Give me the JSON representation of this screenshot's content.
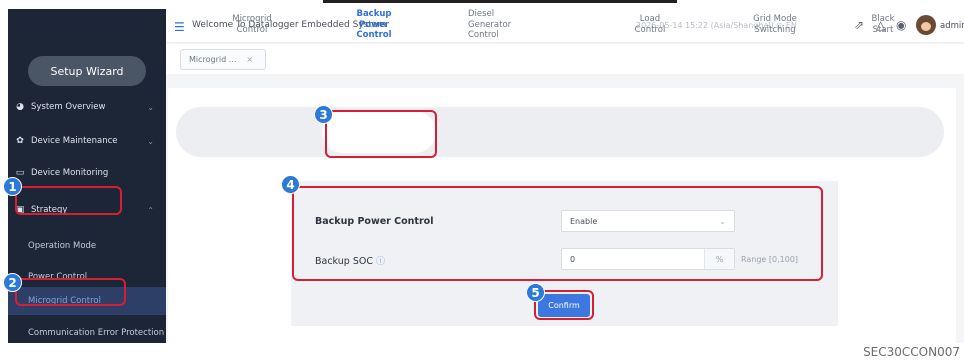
{
  "header": {
    "title": "Welcome To Datalogger Embedded System",
    "datetime": "2026-05-14 15:22 (Asia/Shanghai)",
    "language": "EN",
    "username": "admin"
  },
  "sidebar": {
    "wizard_label": "Setup Wizard",
    "items": [
      {
        "label": "System Overview"
      },
      {
        "label": "Device Maintenance"
      },
      {
        "label": "Device Monitoring"
      },
      {
        "label": "Strategy"
      }
    ],
    "sub_items": [
      {
        "label": "Operation Mode"
      },
      {
        "label": "Power Control"
      },
      {
        "label": "Microgrid Control"
      },
      {
        "label": "Communication Error Protection"
      }
    ]
  },
  "tabs": [
    {
      "label": "Microgrid ..."
    }
  ],
  "steps": [
    {
      "line1": "Microgrid",
      "line2": "Control",
      "line3": ""
    },
    {
      "line1": "Backup",
      "line2": "Power",
      "line3": "Control"
    },
    {
      "line1": "Diesel",
      "line2": "Generator",
      "line3": "Control"
    },
    {
      "line1": "Load",
      "line2": "Control",
      "line3": ""
    },
    {
      "line1": "Grid Mode",
      "line2": "Switching",
      "line3": ""
    },
    {
      "line1": "Black",
      "line2": "Start",
      "line3": ""
    }
  ],
  "form": {
    "backup_label": "Backup Power Control",
    "backup_value": "Enable",
    "soc_label": "Backup SOC",
    "soc_value": "0",
    "soc_unit": "%",
    "soc_range": "Range [0,100]"
  },
  "confirm_label": "Confirm",
  "annotations": [
    "1",
    "2",
    "3",
    "4",
    "5"
  ],
  "caption": "SEC30CCON007",
  "colors": {
    "accent": "#2f6fd6",
    "sidebar_bg": "#1d2637",
    "highlight": "#d61f36",
    "badge": "#2b79d8"
  }
}
